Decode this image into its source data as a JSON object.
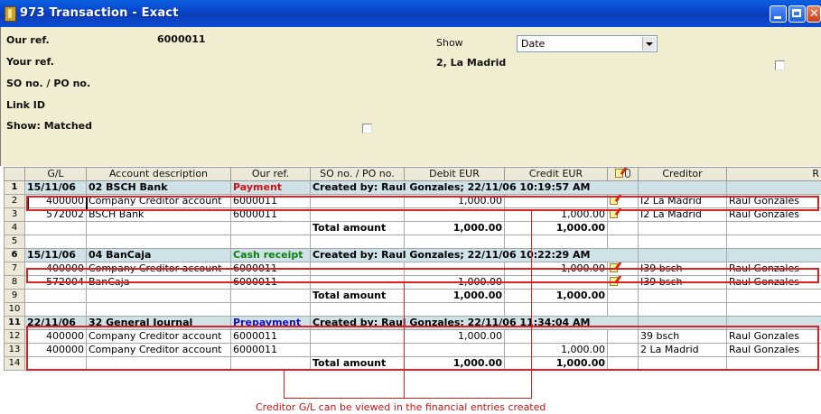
{
  "window": {
    "title": "973 Transaction - Exact"
  },
  "form": {
    "our_ref_label": "Our ref.",
    "our_ref_value": "6000011",
    "your_ref_label": "Your ref.",
    "so_po_label": "SO no. / PO no.",
    "link_id_label": "Link ID",
    "show_matched_label": "Show: Matched",
    "show_label": "Show",
    "show_value": "Date",
    "creditor_value": "2, La Madrid"
  },
  "grid": {
    "headers": [
      "G/L",
      "Account description",
      "Our ref.",
      "SO no. / PO no.",
      "Debit EUR",
      "Credit EUR",
      "",
      "Creditor",
      "R"
    ],
    "rows": [
      {
        "n": "1",
        "type": "section",
        "gl": "15/11/06",
        "desc": "02 BSCH Bank",
        "kind": "Payment",
        "created": "Created by: Raul Gonzales; 22/11/06 10:19:57 AM"
      },
      {
        "n": "2",
        "gl": "400000",
        "desc": "Company Creditor account",
        "ref": "6000011",
        "so": "",
        "debit": "1,000.00",
        "credit": "",
        "note": true,
        "creditor": "I2 La Madrid",
        "user": "Raul Gonzales"
      },
      {
        "n": "3",
        "gl": "572002",
        "desc": "BSCH Bank",
        "ref": "6000011",
        "so": "",
        "debit": "",
        "credit": "1,000.00",
        "note": true,
        "creditor": "I2 La Madrid",
        "user": "Raul Gonzales"
      },
      {
        "n": "4",
        "type": "total",
        "label": "Total amount",
        "debit": "1,000.00",
        "credit": "1,000.00"
      },
      {
        "n": "5",
        "type": "blank"
      },
      {
        "n": "6",
        "type": "section",
        "gl": "15/11/06",
        "desc": "04 BanCaja",
        "kind": "Cash receipt",
        "created": "Created by: Raul Gonzales; 22/11/06 10:22:29 AM"
      },
      {
        "n": "7",
        "gl": "400000",
        "desc": "Company Creditor account",
        "ref": "6000011",
        "so": "",
        "debit": "",
        "credit": "1,000.00",
        "note": true,
        "creditor": "I39 bsch",
        "user": "Raul Gonzales"
      },
      {
        "n": "8",
        "gl": "572004",
        "desc": "BanCaja",
        "ref": "6000011",
        "so": "",
        "debit": "1,000.00",
        "credit": "",
        "note": true,
        "creditor": "I39 bsch",
        "user": "Raul Gonzales"
      },
      {
        "n": "9",
        "type": "total",
        "label": "Total amount",
        "debit": "1,000.00",
        "credit": "1,000.00"
      },
      {
        "n": "10",
        "type": "blank"
      },
      {
        "n": "11",
        "type": "section",
        "gl": "22/11/06",
        "desc": "32 General Journal",
        "kind": "Prepayment",
        "created": "Created by: Raul Gonzales; 22/11/06 11:34:04 AM"
      },
      {
        "n": "12",
        "gl": "400000",
        "desc": "Company Creditor account",
        "ref": "6000011",
        "so": "",
        "debit": "1,000.00",
        "credit": "",
        "note": false,
        "creditor": "39 bsch",
        "user": "Raul Gonzales"
      },
      {
        "n": "13",
        "gl": "400000",
        "desc": "Company Creditor account",
        "ref": "6000011",
        "so": "",
        "debit": "",
        "credit": "1,000.00",
        "note": false,
        "creditor": "2 La Madrid",
        "user": "Raul Gonzales"
      },
      {
        "n": "14",
        "type": "total",
        "label": "Total amount",
        "debit": "1,000.00",
        "credit": "1,000.00"
      }
    ]
  },
  "annotation": {
    "caption": "Creditor G/L can be viewed in the financial entries created"
  },
  "icons": {
    "app": "ledger-book-icon",
    "note": "note-pencil-icon",
    "attachment": "paperclip-icon"
  }
}
